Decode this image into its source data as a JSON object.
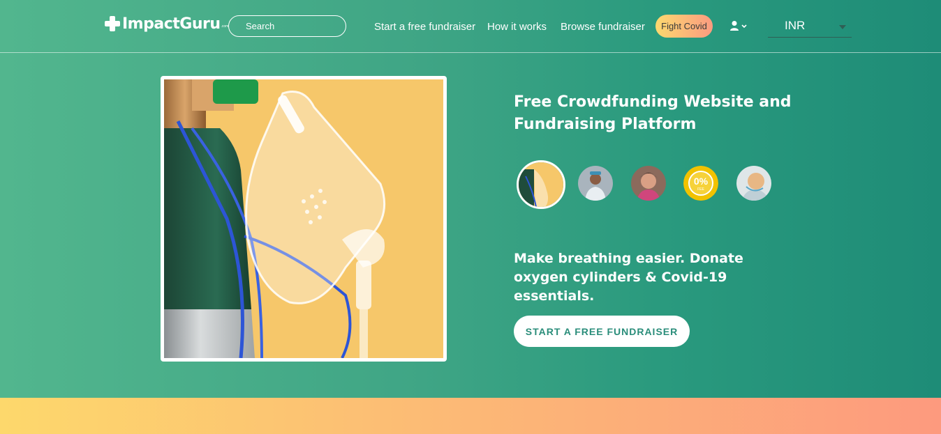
{
  "header": {
    "logo_text": "ImpactGuru",
    "logo_suffix": ".com",
    "search_placeholder": "Search",
    "nav": [
      {
        "label": "Start a free fundraiser"
      },
      {
        "label": "How it works"
      },
      {
        "label": "Browse fundraiser"
      }
    ],
    "fight_covid_label": "Fight Covid",
    "user_icon": "user-icon",
    "currency": "INR"
  },
  "hero": {
    "title": "Free Crowdfunding Website and Fundraising Platform",
    "subtitle": "Make breathing easier. Donate oxygen cylinders & Covid-19 essentials.",
    "cta_label": "START A FREE FUNDRAISER",
    "thumb_badge": "0%",
    "thumb_badge_sub": "FEE"
  },
  "colors": {
    "hero_start": "#52b68e",
    "hero_end": "#1e8c77",
    "cta_text": "#2a8d7a",
    "band_start": "#fdd86c",
    "band_end": "#fd9a7e"
  }
}
